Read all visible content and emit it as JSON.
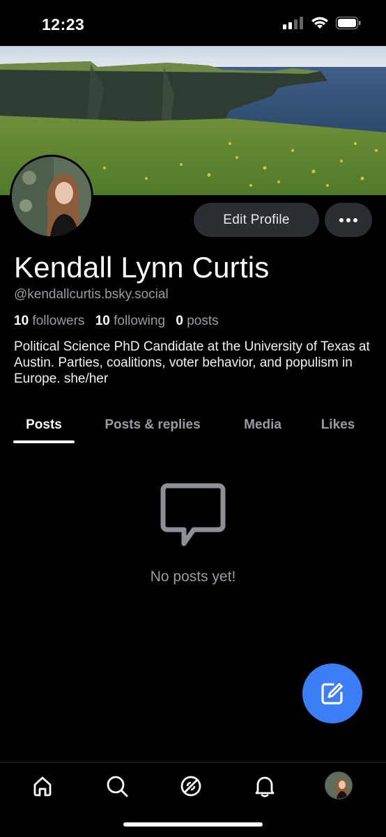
{
  "status_bar": {
    "time": "12:23",
    "icons": [
      "signal-icon",
      "wifi-icon",
      "battery-icon"
    ]
  },
  "profile": {
    "banner": "cliffs-landscape-banner",
    "avatar": "profile-avatar",
    "display_name": "Kendall Lynn Curtis",
    "handle": "@kendallcurtis.bsky.social",
    "followers_count": "10",
    "followers_label": "followers",
    "following_count": "10",
    "following_label": "following",
    "posts_count": "0",
    "posts_label": "posts",
    "bio": "Political Science PhD Candidate at the University of Texas at Austin. Parties, coalitions, voter behavior, and populism in Europe. she/her"
  },
  "actions": {
    "edit_profile_label": "Edit Profile",
    "more_icon": "ellipsis-icon"
  },
  "tabs": [
    {
      "label": "Posts",
      "active": true
    },
    {
      "label": "Posts & replies",
      "active": false
    },
    {
      "label": "Media",
      "active": false
    },
    {
      "label": "Likes",
      "active": false
    }
  ],
  "empty_state": {
    "icon": "speech-bubble-icon",
    "text": "No posts yet!"
  },
  "fab": {
    "icon": "compose-icon",
    "color": "#3c7ef5"
  },
  "bottom_nav": [
    {
      "icon": "home-icon"
    },
    {
      "icon": "search-icon"
    },
    {
      "icon": "feeds-icon"
    },
    {
      "icon": "notifications-icon"
    },
    {
      "icon": "profile-avatar"
    }
  ],
  "colors": {
    "background": "#000000",
    "muted_text": "#9a9ca3",
    "button_bg": "#2b2e33",
    "accent": "#3c7ef5"
  }
}
